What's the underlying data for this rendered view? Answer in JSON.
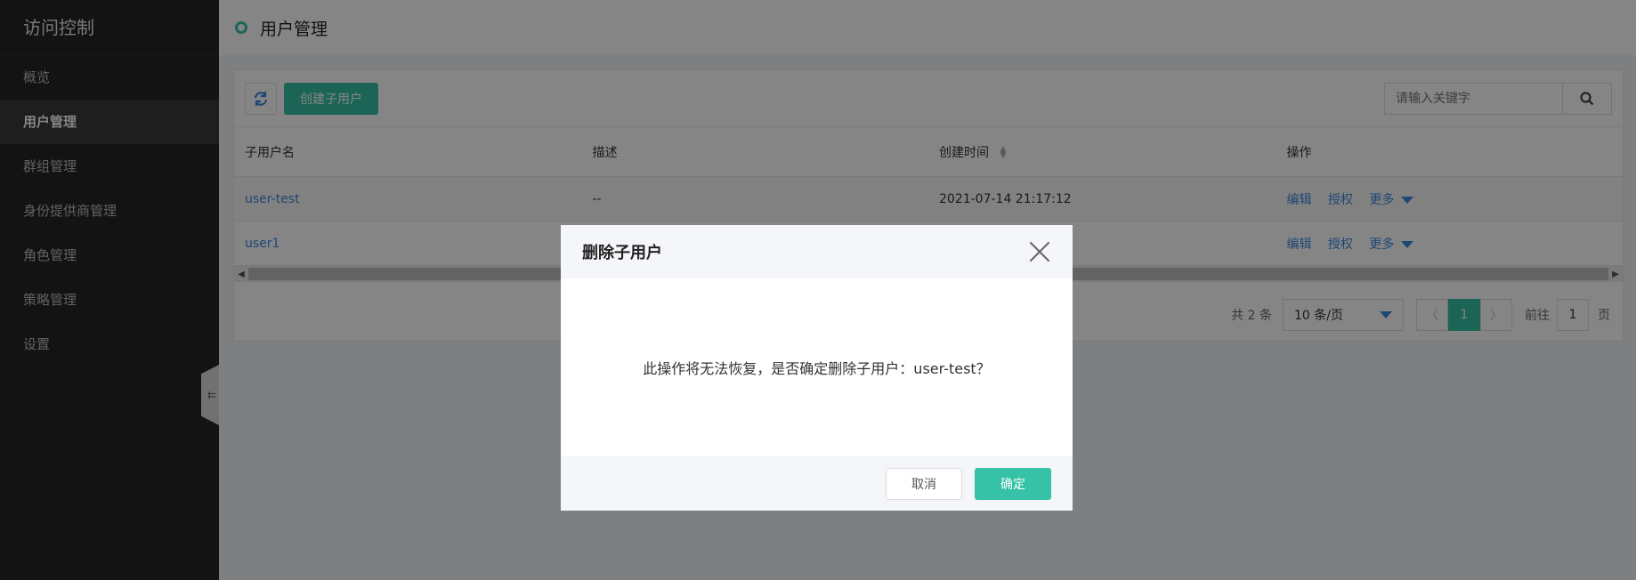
{
  "sidebar": {
    "title": "访问控制",
    "items": [
      {
        "label": "概览"
      },
      {
        "label": "用户管理"
      },
      {
        "label": "群组管理"
      },
      {
        "label": "身份提供商管理"
      },
      {
        "label": "角色管理"
      },
      {
        "label": "策略管理"
      },
      {
        "label": "设置"
      }
    ],
    "active_index": 1,
    "collapse_icon": "collapse-left-icon"
  },
  "header": {
    "title": "用户管理",
    "accent_color": "#36c2a6"
  },
  "toolbar": {
    "refresh_icon": "refresh-icon",
    "create_label": "创建子用户",
    "search_placeholder": "请输入关键字",
    "search_icon": "search-icon"
  },
  "table": {
    "columns": [
      "子用户名",
      "描述",
      "创建时间",
      "操作"
    ],
    "rows": [
      {
        "name": "user-test",
        "desc": "--",
        "created": "2021-07-14 21:17:12"
      },
      {
        "name": "user1",
        "desc": "",
        "created": ""
      }
    ],
    "actions": {
      "edit": "编辑",
      "authorize": "授权",
      "more": "更多"
    }
  },
  "pager": {
    "total": "共 2 条",
    "page_size": "10 条/页",
    "current_page": "1",
    "goto_label": "前往",
    "goto_value": "1",
    "goto_suffix": "页"
  },
  "modal": {
    "title": "删除子用户",
    "message": "此操作将无法恢复，是否确定删除子用户：user-test？",
    "cancel_label": "取消",
    "ok_label": "确定"
  }
}
